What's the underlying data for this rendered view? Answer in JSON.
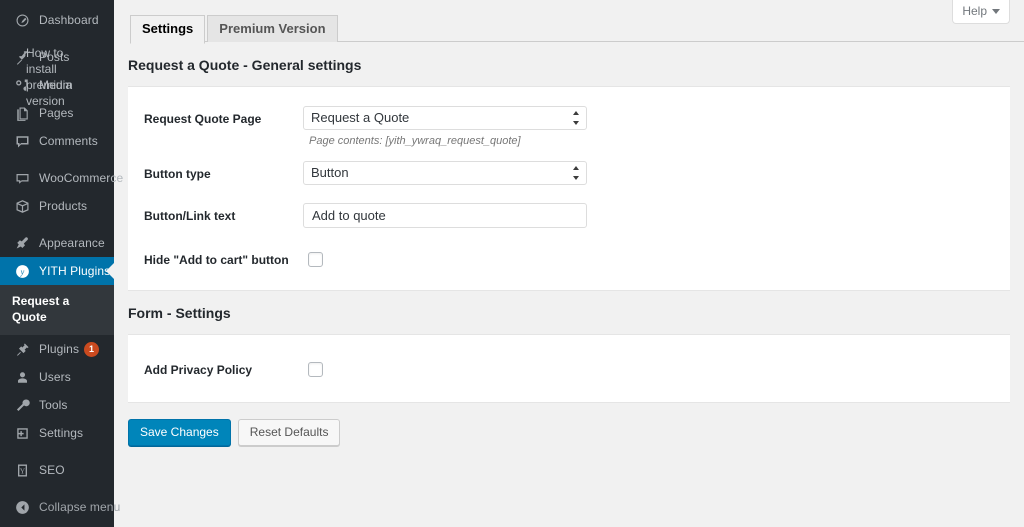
{
  "sidebar": {
    "items": [
      {
        "label": "Dashboard",
        "icon": "dashboard-icon",
        "name": "dashboard",
        "state": "normal",
        "sep_after": true
      },
      {
        "label": "Posts",
        "icon": "pin-icon",
        "name": "posts",
        "state": "normal"
      },
      {
        "label": "Media",
        "icon": "media-icon",
        "name": "media",
        "state": "normal"
      },
      {
        "label": "Pages",
        "icon": "pages-icon",
        "name": "pages",
        "state": "normal"
      },
      {
        "label": "Comments",
        "icon": "comments-icon",
        "name": "comments",
        "state": "normal",
        "sep_after": true
      },
      {
        "label": "WooCommerce",
        "icon": "woocommerce-icon",
        "name": "woocommerce",
        "state": "normal"
      },
      {
        "label": "Products",
        "icon": "products-icon",
        "name": "products",
        "state": "normal",
        "sep_after": true
      },
      {
        "label": "Appearance",
        "icon": "appearance-icon",
        "name": "appearance",
        "state": "normal"
      },
      {
        "label": "YITH Plugins",
        "icon": "yith-icon",
        "name": "yith-plugins",
        "state": "current"
      }
    ],
    "submenu": [
      {
        "label": "Request a Quote",
        "name": "request-a-quote",
        "state": "current"
      },
      {
        "label": "How to install premium version",
        "name": "how-to-install-premium-version",
        "state": "normal"
      }
    ],
    "items_after": [
      {
        "label": "Plugins",
        "icon": "plugins-icon",
        "name": "plugins",
        "badge": "1"
      },
      {
        "label": "Users",
        "icon": "users-icon",
        "name": "users"
      },
      {
        "label": "Tools",
        "icon": "tools-icon",
        "name": "tools"
      },
      {
        "label": "Settings",
        "icon": "settings-icon",
        "name": "settings",
        "sep_after": true
      },
      {
        "label": "SEO",
        "icon": "seo-icon",
        "name": "seo",
        "sep_after": true
      }
    ],
    "collapse": {
      "label": "Collapse menu",
      "icon": "collapse-arrow-icon",
      "name": "collapse-menu"
    }
  },
  "screen_meta": {
    "help_label": "Help"
  },
  "tabs": [
    {
      "label": "Settings",
      "name": "tab-settings",
      "active": true
    },
    {
      "label": "Premium Version",
      "name": "tab-premium-version",
      "active": false
    }
  ],
  "general": {
    "section_title": "Request a Quote - General settings",
    "request_quote_page": {
      "label": "Request Quote Page",
      "value": "Request a Quote",
      "options": [
        "Request a Quote"
      ],
      "description": "Page contents: [yith_ywraq_request_quote]"
    },
    "button_type": {
      "label": "Button type",
      "value": "Button",
      "options": [
        "Button"
      ]
    },
    "button_link_text": {
      "label": "Button/Link text",
      "value": "Add to quote",
      "placeholder": ""
    },
    "hide_add_to_cart": {
      "label": "Hide \"Add to cart\" button",
      "checked": false
    }
  },
  "form_settings": {
    "section_title": "Form - Settings",
    "add_privacy_policy": {
      "label": "Add Privacy Policy",
      "checked": false
    }
  },
  "actions": {
    "save_label": "Save Changes",
    "reset_label": "Reset Defaults"
  },
  "colors": {
    "sidebar_bg": "#23282d",
    "submenu_bg": "#32373c",
    "accent_blue": "#0073aa",
    "primary_button": "#0085ba",
    "badge_red": "#ca4a1f",
    "page_bg": "#f1f1f1",
    "panel_bg": "#ffffff"
  }
}
